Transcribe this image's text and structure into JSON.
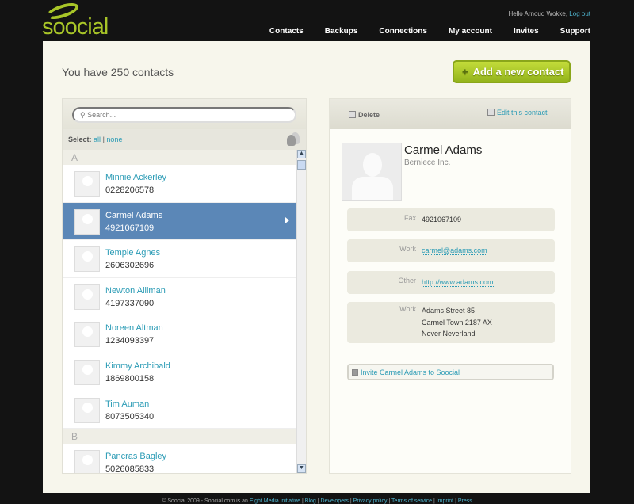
{
  "header": {
    "logo": "soocial",
    "greeting": "Hello Arnoud Wokke,",
    "logout": "Log out",
    "nav": [
      "Contacts",
      "Backups",
      "Connections",
      "My account",
      "Invites",
      "Support"
    ]
  },
  "main": {
    "title": "You have 250 contacts",
    "add_button": "Add a new contact",
    "add_icon": "+"
  },
  "list": {
    "search_placeholder": "Search...",
    "select_label": "Select:",
    "select_all": "all",
    "select_sep": "|",
    "select_none": "none",
    "groups": [
      {
        "letter": "A",
        "contacts": [
          {
            "name": "Minnie Ackerley",
            "phone": "0228206578"
          },
          {
            "name": "Carmel Adams",
            "phone": "4921067109",
            "selected": true
          },
          {
            "name": "Temple Agnes",
            "phone": "2606302696"
          },
          {
            "name": "Newton Alliman",
            "phone": "4197337090"
          },
          {
            "name": "Noreen Altman",
            "phone": "1234093397"
          },
          {
            "name": "Kimmy Archibald",
            "phone": "1869800158"
          },
          {
            "name": "Tim Auman",
            "phone": "8073505340"
          }
        ]
      },
      {
        "letter": "B",
        "contacts": [
          {
            "name": "Pancras Bagley",
            "phone": "5026085833"
          }
        ]
      }
    ]
  },
  "detail": {
    "delete": "Delete",
    "edit": "Edit this contact",
    "name": "Carmel Adams",
    "company": "Berniece Inc.",
    "fields": [
      {
        "label": "Fax",
        "value": "4921067109"
      },
      {
        "label": "Work",
        "value": "carmel@adams.com",
        "link": true
      },
      {
        "label": "Other",
        "value": "http://www.adams.com",
        "link": true
      },
      {
        "label": "Work",
        "lines": [
          "Adams Street 85",
          "Carmel Town 2187 AX",
          "Never Neverland"
        ]
      }
    ],
    "invite": "Invite Carmel Adams to Soocial"
  },
  "footer": {
    "copyright": "© Soocial 2009 - Soocial.com is an",
    "links": [
      "Eight Media initiative",
      "Blog",
      "Developers",
      "Privacy policy",
      "Terms of service",
      "Imprint",
      "Press"
    ]
  },
  "colors": {
    "accent": "#a8c528",
    "link": "#2a9bb5",
    "selected": "#5b87b7"
  }
}
